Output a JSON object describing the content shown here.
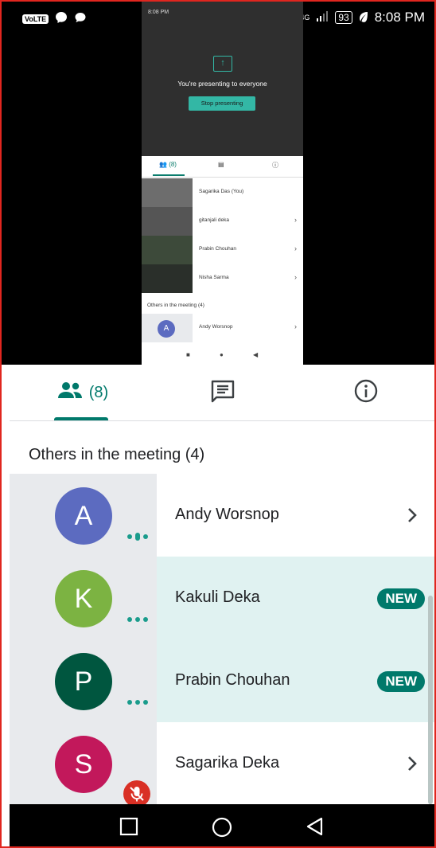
{
  "status_bar": {
    "volte": "VoLTE",
    "network": "4G",
    "battery": "93",
    "time": "8:08 PM"
  },
  "preview": {
    "time": "8:08 PM",
    "presenting_text": "You're presenting to everyone",
    "stop_button": "Stop presenting",
    "people_tab": "(8)",
    "participants": [
      {
        "name": "Sagarika Das (You)"
      },
      {
        "name": "gitanjali deka"
      },
      {
        "name": "Prabin Chouhan"
      },
      {
        "name": "Nisha Sarma"
      }
    ],
    "others_title": "Others in the meeting (4)",
    "others": [
      {
        "initial": "A",
        "name": "Andy Worsnop"
      }
    ]
  },
  "tabs": {
    "people_count": "(8)",
    "chat_icon": "chat-icon",
    "info_icon": "info-icon"
  },
  "section": {
    "title": "Others in the meeting (4)"
  },
  "participants": [
    {
      "initial": "A",
      "name": "Andy Worsnop",
      "avatar_color": "#5c6bc0",
      "status": "speaking",
      "action": "chevron",
      "highlight": false
    },
    {
      "initial": "K",
      "name": "Kakuli Deka",
      "avatar_color": "#7cb342",
      "status": "dots",
      "action": "badge",
      "badge": "NEW",
      "highlight": true
    },
    {
      "initial": "P",
      "name": "Prabin Chouhan",
      "avatar_color": "#00563f",
      "status": "dots",
      "action": "badge",
      "badge": "NEW",
      "highlight": true
    },
    {
      "initial": "S",
      "name": "Sagarika Deka",
      "avatar_color": "#c2185b",
      "status": "muted",
      "action": "chevron",
      "highlight": false
    }
  ],
  "colors": {
    "accent": "#00796b",
    "highlight_row": "#e0f2f1",
    "mute_red": "#d93025"
  },
  "nav": {
    "recents_icon": "square-icon",
    "home_icon": "circle-icon",
    "back_icon": "triangle-back-icon"
  }
}
